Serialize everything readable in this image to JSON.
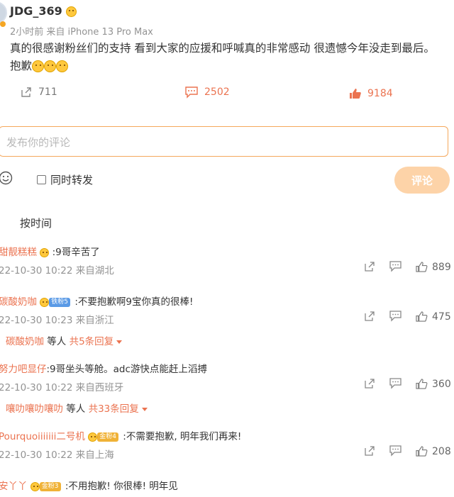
{
  "post": {
    "author": "JDG_369",
    "meta": "2小时前 来自 iPhone 13 Pro Max",
    "body": "真的很感谢粉丝们的支持 看到大家的应援和呼喊真的非常感动 很遗憾今年没走到最后。抱歉",
    "shares": "711",
    "comments": "2502",
    "likes": "9184"
  },
  "composer": {
    "placeholder": "发布你的评论",
    "repost_label": "同时转发",
    "submit_label": "评论"
  },
  "sort_label": "按时间",
  "comments": [
    {
      "user": "甜靓糕糕",
      "badge": "",
      "text": ":9哥辛苦了",
      "meta": "22-10-30 10:22 来自湖北",
      "likes": "889",
      "replies_user": "",
      "replies_mid": "",
      "replies_more": ""
    },
    {
      "user": "碳酸奶咖",
      "badge": "铁粉5",
      "text": ":不要抱歉啊9宝你真的很棒!",
      "meta": "22-10-30 10:23 来自浙江",
      "likes": "475",
      "replies_user": "碳酸奶咖",
      "replies_mid": " 等人 ",
      "replies_more": "共5条回复"
    },
    {
      "user": "努力吧显仔",
      "badge": "",
      "text": ":9哥坐头等舱。adc游快点能赶上滔搏",
      "meta": "22-10-30 10:22 来自西班牙",
      "likes": "360",
      "replies_user": "嚷叻嚷叻嚷叻",
      "replies_mid": " 等人 ",
      "replies_more": "共33条回复"
    },
    {
      "user": "Pourquoiiiiiii二号机",
      "badge": "金粉4",
      "text": ":不需要抱歉, 明年我们再来!",
      "meta": "22-10-30 10:22 来自上海",
      "likes": "208",
      "replies_user": "",
      "replies_mid": "",
      "replies_more": ""
    },
    {
      "user": "安丫丫",
      "badge": "金粉3",
      "text": ":不用抱歉! 你很棒! 明年见",
      "meta": "",
      "likes": "",
      "replies_user": "",
      "replies_mid": "",
      "replies_more": ""
    }
  ],
  "colors": {
    "accent": "#eb7350",
    "input_border": "#f5a85c",
    "submit_bg": "#fdd3a8",
    "meta_gray": "#939393"
  },
  "icons": {
    "share": "share-icon",
    "comment": "comment-icon",
    "like": "thumbs-up-icon",
    "emoji": "smiley-icon",
    "reply": "reply-icon",
    "chat": "chat-icon"
  }
}
